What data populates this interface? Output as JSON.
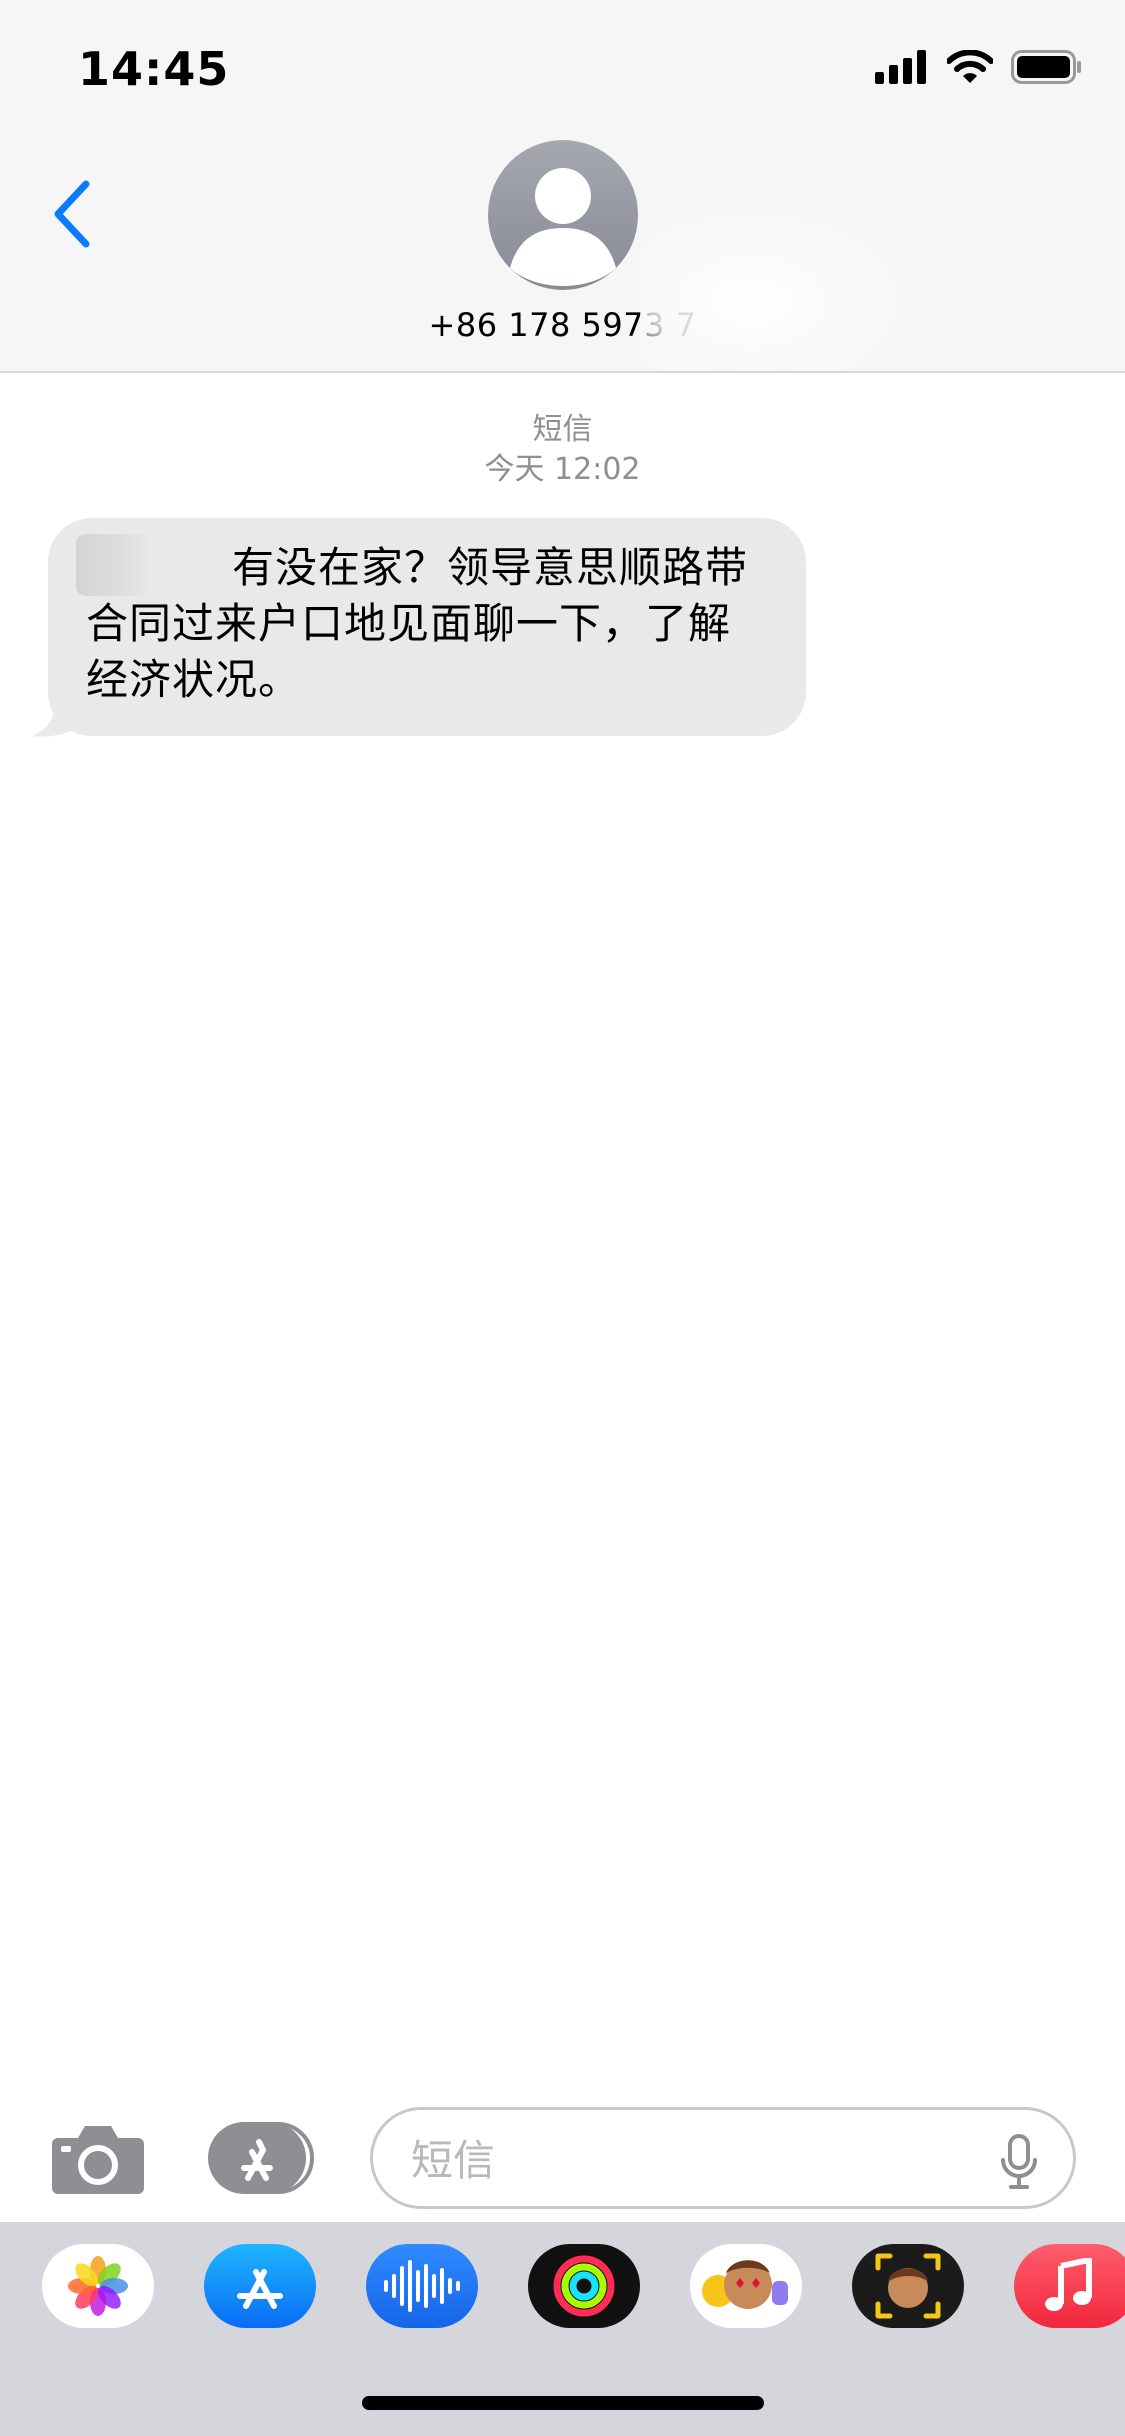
{
  "status_bar": {
    "time": "14:45"
  },
  "header": {
    "contact_name": "+86 178 5973 7"
  },
  "conversation": {
    "service": "短信",
    "timestamp": "今天 12:02"
  },
  "messages": [
    {
      "direction": "incoming",
      "text": "有没在家？领导意思顺路带合同过来户口地见面聊一下，了解经济状况。"
    }
  ],
  "input": {
    "placeholder": "短信"
  },
  "app_drawer": {
    "apps": [
      "photos-icon",
      "app-store-icon",
      "audio-message-icon",
      "activity-icon",
      "memoji-stickers-icon",
      "memoji-camera-icon",
      "music-icon"
    ]
  },
  "colors": {
    "accent": "#0a7aff",
    "bubble_incoming": "#e9e9eb",
    "secondary_text": "#8e8e93"
  }
}
